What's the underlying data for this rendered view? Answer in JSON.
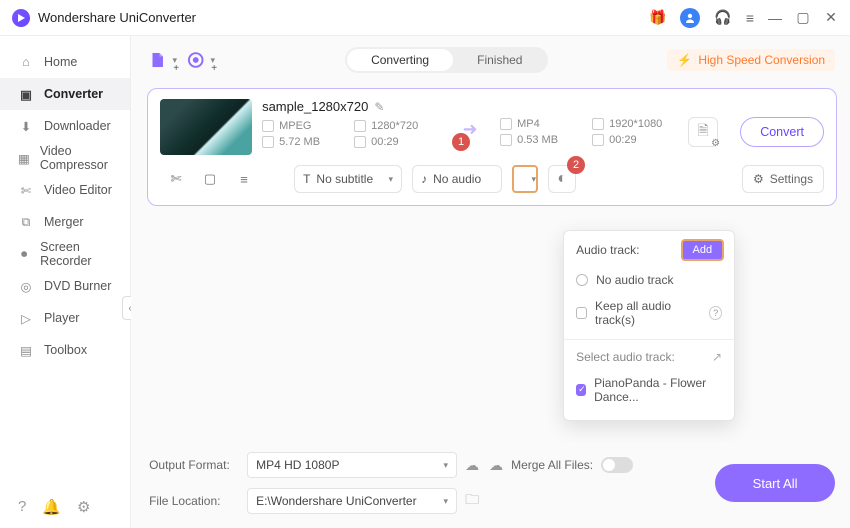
{
  "app": {
    "title": "Wondershare UniConverter"
  },
  "titlebar_icons": {
    "gift": "gift-icon",
    "avatar": "user-avatar",
    "support": "headset-icon",
    "menu": "menu-icon",
    "minimize": "minimize-icon",
    "maximize": "maximize-icon",
    "close": "close-icon"
  },
  "sidebar": {
    "items": [
      {
        "label": "Home",
        "icon": "home-icon"
      },
      {
        "label": "Converter",
        "icon": "converter-icon",
        "active": true
      },
      {
        "label": "Downloader",
        "icon": "downloader-icon"
      },
      {
        "label": "Video Compressor",
        "icon": "compressor-icon"
      },
      {
        "label": "Video Editor",
        "icon": "editor-icon"
      },
      {
        "label": "Merger",
        "icon": "merger-icon"
      },
      {
        "label": "Screen Recorder",
        "icon": "recorder-icon"
      },
      {
        "label": "DVD Burner",
        "icon": "dvd-icon"
      },
      {
        "label": "Player",
        "icon": "player-icon"
      },
      {
        "label": "Toolbox",
        "icon": "toolbox-icon"
      }
    ],
    "bottom": [
      "help-icon",
      "bell-icon",
      "settings-icon"
    ]
  },
  "toolbar": {
    "add_file": "add-file-icon",
    "add_url": "add-url-icon",
    "tabs": {
      "converting": "Converting",
      "finished": "Finished",
      "active": "converting"
    },
    "hsc": "High Speed Conversion"
  },
  "file": {
    "name": "sample_1280x720",
    "src": {
      "format": "MPEG",
      "resolution": "1280*720",
      "size": "5.72 MB",
      "duration": "00:29"
    },
    "dst": {
      "format": "MP4",
      "resolution": "1920*1080",
      "size": "0.53 MB",
      "duration": "00:29"
    },
    "convert_label": "Convert",
    "subtitle": {
      "label": "No subtitle"
    },
    "audio": {
      "label": "No audio"
    },
    "settings_label": "Settings",
    "badges": {
      "one": "1",
      "two": "2"
    }
  },
  "audio_dropdown": {
    "header": "Audio track:",
    "add_btn": "Add",
    "no_audio": "No audio track",
    "keep_all": "Keep all audio track(s)",
    "select_label": "Select audio track:",
    "tracks": [
      {
        "label": "PianoPanda - Flower Dance...",
        "checked": true
      }
    ]
  },
  "footer": {
    "output_format_label": "Output Format:",
    "output_format_value": "MP4 HD 1080P",
    "file_location_label": "File Location:",
    "file_location_value": "E:\\Wondershare UniConverter",
    "merge_label": "Merge All Files:",
    "start_all": "Start All"
  }
}
